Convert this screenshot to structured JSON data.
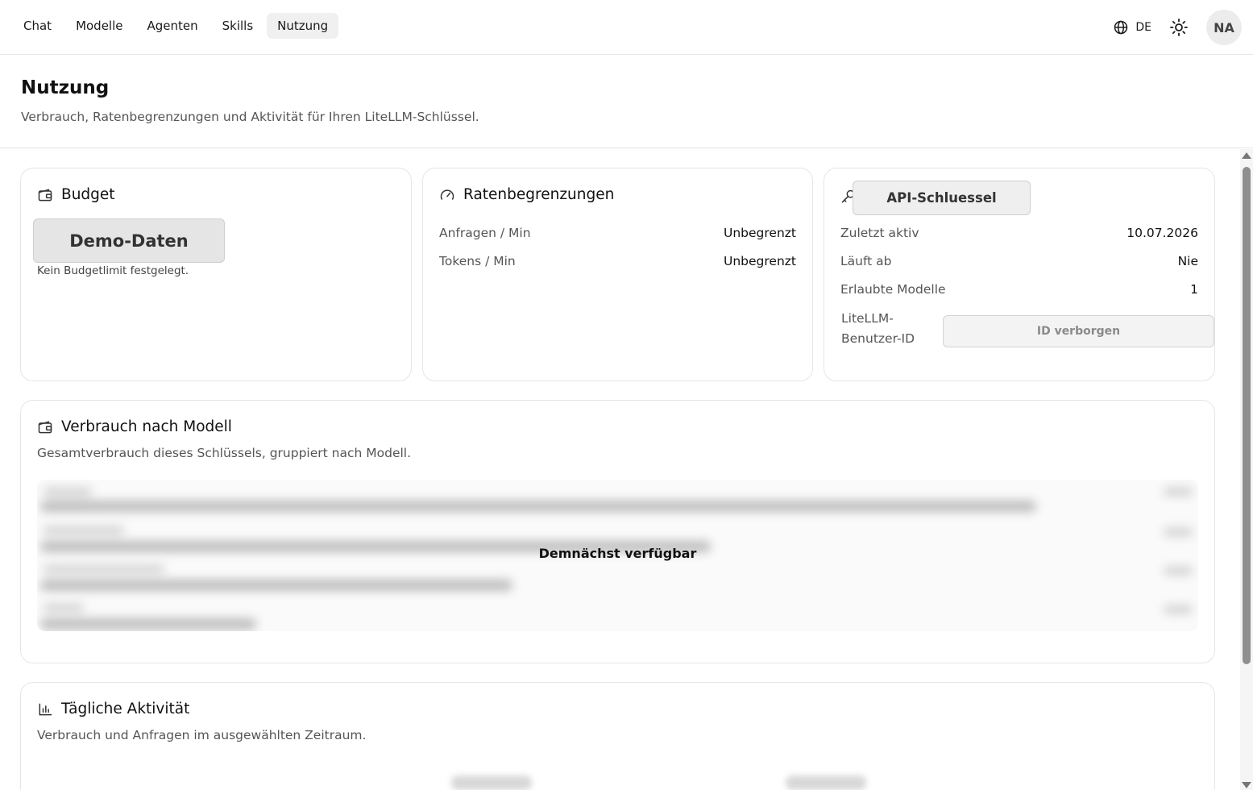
{
  "nav": {
    "items": [
      {
        "label": "Chat"
      },
      {
        "label": "Modelle"
      },
      {
        "label": "Agenten"
      },
      {
        "label": "Skills"
      },
      {
        "label": "Nutzung"
      }
    ],
    "active": "Nutzung",
    "language": "DE",
    "avatar_initials": "NA"
  },
  "header": {
    "title": "Nutzung",
    "subtitle": "Verbrauch, Ratenbegrenzungen und Aktivität für Ihren LiteLLM-Schlüssel."
  },
  "budget": {
    "title": "Budget",
    "demo_label": "Demo-Daten",
    "note": "Kein Budgetlimit festgelegt."
  },
  "rate_limits": {
    "title": "Ratenbegrenzungen",
    "rows": [
      {
        "key": "Anfragen / Min",
        "value": "Unbegrenzt"
      },
      {
        "key": "Tokens / Min",
        "value": "Unbegrenzt"
      }
    ]
  },
  "api_key": {
    "button_label": "API-Schluessel",
    "rows": [
      {
        "key": "Zuletzt aktiv",
        "value": "10.07.2026"
      },
      {
        "key": "Läuft ab",
        "value": "Nie"
      },
      {
        "key": "Erlaubte Modelle",
        "value": "1"
      }
    ],
    "user_id_label_line1": "LiteLLM-",
    "user_id_label_line2": "Benutzer-ID",
    "user_id_button": "ID verborgen"
  },
  "usage_by_model": {
    "title": "Verbrauch nach Modell",
    "description": "Gesamtverbrauch dieses Schlüssels, gruppiert nach Modell.",
    "overlay": "Demnächst verfügbar"
  },
  "daily_activity": {
    "title": "Tägliche Aktivität",
    "description": "Verbrauch und Anfragen im ausgewählten Zeitraum."
  },
  "colors": {
    "border": "#e5e5e5",
    "active_nav_bg": "#f0f0f0",
    "muted_text": "#555555"
  }
}
